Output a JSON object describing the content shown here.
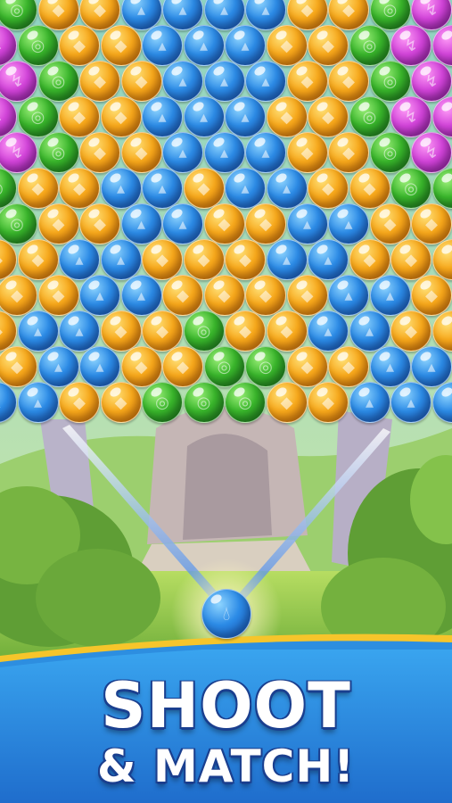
{
  "cta": {
    "line1": "SHOOT",
    "line2": "& MATCH!"
  },
  "colors": {
    "blue": "#2c8be6",
    "orange": "#f7a81b",
    "green": "#39b52b",
    "purple": "#d244d9",
    "banner": "#2d8ee0"
  },
  "icons": {
    "blue": "water-drop-icon",
    "orange": "flame-icon",
    "green": "swirl-icon",
    "purple": "lightning-icon"
  },
  "shooter": {
    "color": "blue"
  },
  "bubble_rows": [
    [
      "green",
      "orange",
      "orange",
      "blue",
      "blue",
      "blue",
      "blue",
      "orange",
      "orange",
      "green",
      "purple"
    ],
    [
      "purple",
      "green",
      "orange",
      "orange",
      "blue",
      "blue",
      "blue",
      "orange",
      "orange",
      "green",
      "purple"
    ],
    [
      "purple",
      "green",
      "orange",
      "orange",
      "blue",
      "blue",
      "blue",
      "orange",
      "orange",
      "green",
      "purple"
    ],
    [
      "purple",
      "green",
      "orange",
      "orange",
      "blue",
      "blue",
      "blue",
      "orange",
      "orange",
      "green",
      "purple"
    ],
    [
      "purple",
      "green",
      "orange",
      "orange",
      "blue",
      "blue",
      "blue",
      "orange",
      "orange",
      "green",
      "purple"
    ],
    [
      "green",
      "orange",
      "orange",
      "blue",
      "blue",
      "orange",
      "blue",
      "blue",
      "orange",
      "orange",
      "green"
    ],
    [
      "green",
      "orange",
      "orange",
      "blue",
      "blue",
      "orange",
      "orange",
      "blue",
      "blue",
      "orange",
      "orange"
    ],
    [
      "orange",
      "orange",
      "blue",
      "blue",
      "orange",
      "orange",
      "orange",
      "blue",
      "blue",
      "orange",
      "orange"
    ],
    [
      "orange",
      "orange",
      "blue",
      "blue",
      "orange",
      "orange",
      "orange",
      "orange",
      "blue",
      "blue",
      "orange"
    ],
    [
      "orange",
      "blue",
      "blue",
      "orange",
      "orange",
      "green",
      "orange",
      "orange",
      "blue",
      "blue",
      "orange"
    ],
    [
      "orange",
      "blue",
      "blue",
      "orange",
      "orange",
      "green",
      "green",
      "orange",
      "orange",
      "blue",
      "blue"
    ],
    [
      "blue",
      "blue",
      "orange",
      "orange",
      "green",
      "green",
      "green",
      "orange",
      "orange",
      "blue",
      "blue"
    ]
  ]
}
